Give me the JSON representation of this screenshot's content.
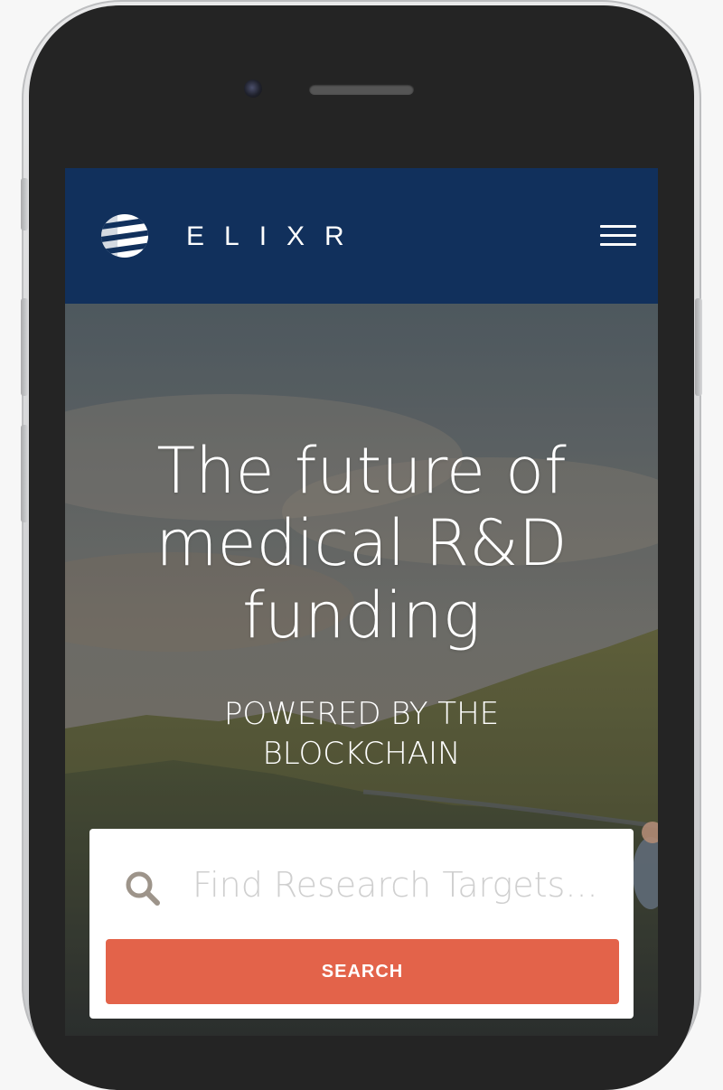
{
  "brand": {
    "name": "ELIXR",
    "logo_icon": "elixr-stripes-logo-icon"
  },
  "nav": {
    "menu_icon": "hamburger-menu-icon"
  },
  "hero": {
    "headline": "The future of\nmedical R&D\nfunding",
    "subheadline": "POWERED BY THE\nBLOCKCHAIN"
  },
  "search": {
    "icon": "search-icon",
    "placeholder": "Find Research Targets...",
    "button_label": "SEARCH"
  },
  "colors": {
    "navbar": "#11305c",
    "accent": "#e3634a",
    "card": "#ffffff",
    "icon": "#9d948a"
  }
}
